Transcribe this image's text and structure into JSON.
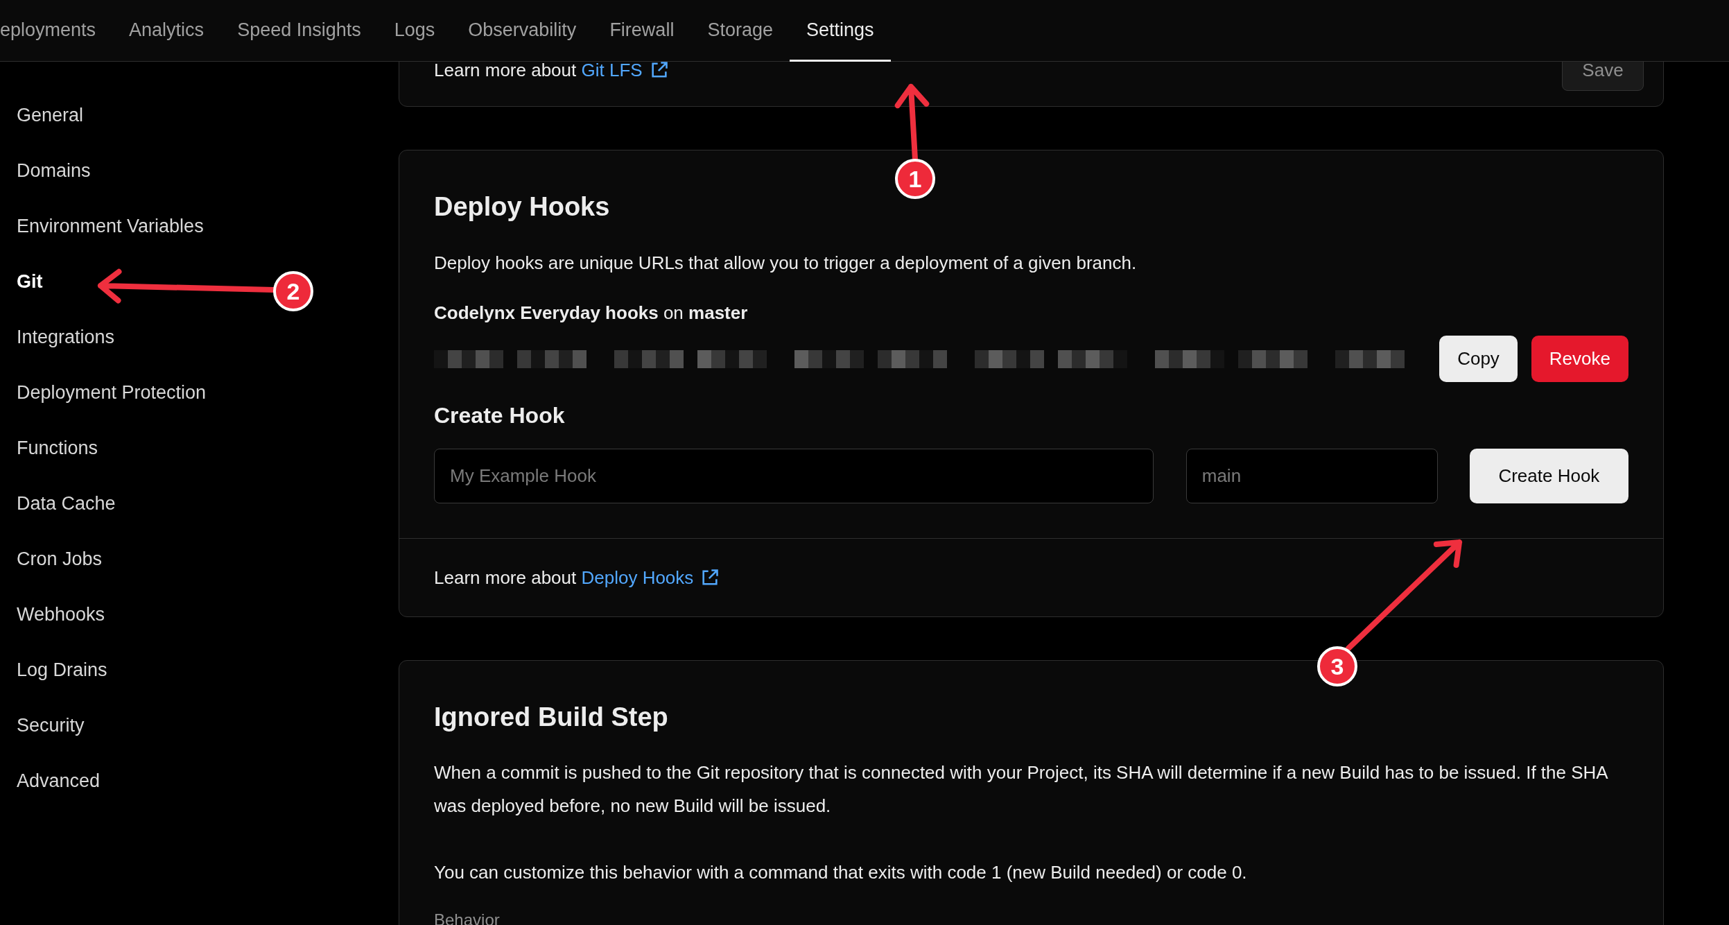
{
  "nav": {
    "tabs": [
      {
        "label": "eployments",
        "selected": false
      },
      {
        "label": "Analytics",
        "selected": false
      },
      {
        "label": "Speed Insights",
        "selected": false
      },
      {
        "label": "Logs",
        "selected": false
      },
      {
        "label": "Observability",
        "selected": false
      },
      {
        "label": "Firewall",
        "selected": false
      },
      {
        "label": "Storage",
        "selected": false
      },
      {
        "label": "Settings",
        "selected": true
      }
    ]
  },
  "sidebar": {
    "items": [
      {
        "label": "General",
        "selected": false
      },
      {
        "label": "Domains",
        "selected": false
      },
      {
        "label": "Environment Variables",
        "selected": false
      },
      {
        "label": "Git",
        "selected": true
      },
      {
        "label": "Integrations",
        "selected": false
      },
      {
        "label": "Deployment Protection",
        "selected": false
      },
      {
        "label": "Functions",
        "selected": false
      },
      {
        "label": "Data Cache",
        "selected": false
      },
      {
        "label": "Cron Jobs",
        "selected": false
      },
      {
        "label": "Webhooks",
        "selected": false
      },
      {
        "label": "Log Drains",
        "selected": false
      },
      {
        "label": "Security",
        "selected": false
      },
      {
        "label": "Advanced",
        "selected": false
      }
    ]
  },
  "git_lfs_card": {
    "footer": {
      "text": "Learn more about ",
      "link": "Git LFS"
    },
    "save_button": {
      "label": "Save",
      "disabled": true
    }
  },
  "deploy_hooks_card": {
    "title": "Deploy Hooks",
    "description": "Deploy hooks are unique URLs that allow you to trigger a deployment of a given branch.",
    "hook": {
      "name": "**Codelynx Everyday hooks** on **master**",
      "copy_button": "Copy",
      "revoke_button": "Revoke"
    },
    "create": {
      "title": "Create Hook",
      "name_field": {
        "placeholder": "My Example Hook"
      },
      "branch_field": {
        "placeholder": "main"
      },
      "button": "Create Hook"
    },
    "footer": {
      "text": "Learn more about ",
      "link": "Deploy Hooks"
    }
  },
  "ignored_build_step_card": {
    "title": "Ignored Build Step",
    "paragraphs": [
      "When a commit is pushed to the Git repository that is connected with your Project, its SHA will determine if a new Build has to be issued. If the SHA was deployed before, no new Build will be issued.",
      "You can customize this behavior with a command that exits with code 1 (new Build needed) or code 0."
    ],
    "behavior_label": "Behavior"
  },
  "annotations": [
    {
      "label": "1"
    },
    {
      "label": "2"
    },
    {
      "label": "3"
    }
  ]
}
